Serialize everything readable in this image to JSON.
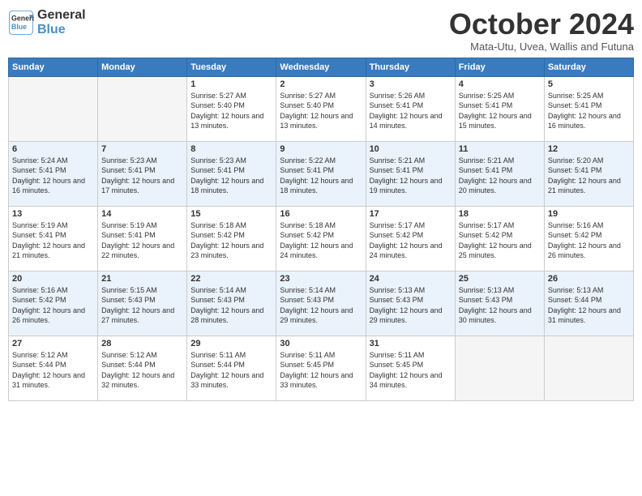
{
  "app": {
    "name": "GeneralBlue",
    "name_line1": "General",
    "name_line2": "Blue"
  },
  "calendar": {
    "month": "October 2024",
    "location": "Mata-Utu, Uvea, Wallis and Futuna",
    "weekdays": [
      "Sunday",
      "Monday",
      "Tuesday",
      "Wednesday",
      "Thursday",
      "Friday",
      "Saturday"
    ],
    "weeks": [
      [
        {
          "day": "",
          "sunrise": "",
          "sunset": "",
          "daylight": ""
        },
        {
          "day": "",
          "sunrise": "",
          "sunset": "",
          "daylight": ""
        },
        {
          "day": "1",
          "sunrise": "Sunrise: 5:27 AM",
          "sunset": "Sunset: 5:40 PM",
          "daylight": "Daylight: 12 hours and 13 minutes."
        },
        {
          "day": "2",
          "sunrise": "Sunrise: 5:27 AM",
          "sunset": "Sunset: 5:40 PM",
          "daylight": "Daylight: 12 hours and 13 minutes."
        },
        {
          "day": "3",
          "sunrise": "Sunrise: 5:26 AM",
          "sunset": "Sunset: 5:41 PM",
          "daylight": "Daylight: 12 hours and 14 minutes."
        },
        {
          "day": "4",
          "sunrise": "Sunrise: 5:25 AM",
          "sunset": "Sunset: 5:41 PM",
          "daylight": "Daylight: 12 hours and 15 minutes."
        },
        {
          "day": "5",
          "sunrise": "Sunrise: 5:25 AM",
          "sunset": "Sunset: 5:41 PM",
          "daylight": "Daylight: 12 hours and 16 minutes."
        }
      ],
      [
        {
          "day": "6",
          "sunrise": "Sunrise: 5:24 AM",
          "sunset": "Sunset: 5:41 PM",
          "daylight": "Daylight: 12 hours and 16 minutes."
        },
        {
          "day": "7",
          "sunrise": "Sunrise: 5:23 AM",
          "sunset": "Sunset: 5:41 PM",
          "daylight": "Daylight: 12 hours and 17 minutes."
        },
        {
          "day": "8",
          "sunrise": "Sunrise: 5:23 AM",
          "sunset": "Sunset: 5:41 PM",
          "daylight": "Daylight: 12 hours and 18 minutes."
        },
        {
          "day": "9",
          "sunrise": "Sunrise: 5:22 AM",
          "sunset": "Sunset: 5:41 PM",
          "daylight": "Daylight: 12 hours and 18 minutes."
        },
        {
          "day": "10",
          "sunrise": "Sunrise: 5:21 AM",
          "sunset": "Sunset: 5:41 PM",
          "daylight": "Daylight: 12 hours and 19 minutes."
        },
        {
          "day": "11",
          "sunrise": "Sunrise: 5:21 AM",
          "sunset": "Sunset: 5:41 PM",
          "daylight": "Daylight: 12 hours and 20 minutes."
        },
        {
          "day": "12",
          "sunrise": "Sunrise: 5:20 AM",
          "sunset": "Sunset: 5:41 PM",
          "daylight": "Daylight: 12 hours and 21 minutes."
        }
      ],
      [
        {
          "day": "13",
          "sunrise": "Sunrise: 5:19 AM",
          "sunset": "Sunset: 5:41 PM",
          "daylight": "Daylight: 12 hours and 21 minutes."
        },
        {
          "day": "14",
          "sunrise": "Sunrise: 5:19 AM",
          "sunset": "Sunset: 5:41 PM",
          "daylight": "Daylight: 12 hours and 22 minutes."
        },
        {
          "day": "15",
          "sunrise": "Sunrise: 5:18 AM",
          "sunset": "Sunset: 5:42 PM",
          "daylight": "Daylight: 12 hours and 23 minutes."
        },
        {
          "day": "16",
          "sunrise": "Sunrise: 5:18 AM",
          "sunset": "Sunset: 5:42 PM",
          "daylight": "Daylight: 12 hours and 24 minutes."
        },
        {
          "day": "17",
          "sunrise": "Sunrise: 5:17 AM",
          "sunset": "Sunset: 5:42 PM",
          "daylight": "Daylight: 12 hours and 24 minutes."
        },
        {
          "day": "18",
          "sunrise": "Sunrise: 5:17 AM",
          "sunset": "Sunset: 5:42 PM",
          "daylight": "Daylight: 12 hours and 25 minutes."
        },
        {
          "day": "19",
          "sunrise": "Sunrise: 5:16 AM",
          "sunset": "Sunset: 5:42 PM",
          "daylight": "Daylight: 12 hours and 26 minutes."
        }
      ],
      [
        {
          "day": "20",
          "sunrise": "Sunrise: 5:16 AM",
          "sunset": "Sunset: 5:42 PM",
          "daylight": "Daylight: 12 hours and 26 minutes."
        },
        {
          "day": "21",
          "sunrise": "Sunrise: 5:15 AM",
          "sunset": "Sunset: 5:43 PM",
          "daylight": "Daylight: 12 hours and 27 minutes."
        },
        {
          "day": "22",
          "sunrise": "Sunrise: 5:14 AM",
          "sunset": "Sunset: 5:43 PM",
          "daylight": "Daylight: 12 hours and 28 minutes."
        },
        {
          "day": "23",
          "sunrise": "Sunrise: 5:14 AM",
          "sunset": "Sunset: 5:43 PM",
          "daylight": "Daylight: 12 hours and 29 minutes."
        },
        {
          "day": "24",
          "sunrise": "Sunrise: 5:13 AM",
          "sunset": "Sunset: 5:43 PM",
          "daylight": "Daylight: 12 hours and 29 minutes."
        },
        {
          "day": "25",
          "sunrise": "Sunrise: 5:13 AM",
          "sunset": "Sunset: 5:43 PM",
          "daylight": "Daylight: 12 hours and 30 minutes."
        },
        {
          "day": "26",
          "sunrise": "Sunrise: 5:13 AM",
          "sunset": "Sunset: 5:44 PM",
          "daylight": "Daylight: 12 hours and 31 minutes."
        }
      ],
      [
        {
          "day": "27",
          "sunrise": "Sunrise: 5:12 AM",
          "sunset": "Sunset: 5:44 PM",
          "daylight": "Daylight: 12 hours and 31 minutes."
        },
        {
          "day": "28",
          "sunrise": "Sunrise: 5:12 AM",
          "sunset": "Sunset: 5:44 PM",
          "daylight": "Daylight: 12 hours and 32 minutes."
        },
        {
          "day": "29",
          "sunrise": "Sunrise: 5:11 AM",
          "sunset": "Sunset: 5:44 PM",
          "daylight": "Daylight: 12 hours and 33 minutes."
        },
        {
          "day": "30",
          "sunrise": "Sunrise: 5:11 AM",
          "sunset": "Sunset: 5:45 PM",
          "daylight": "Daylight: 12 hours and 33 minutes."
        },
        {
          "day": "31",
          "sunrise": "Sunrise: 5:11 AM",
          "sunset": "Sunset: 5:45 PM",
          "daylight": "Daylight: 12 hours and 34 minutes."
        },
        {
          "day": "",
          "sunrise": "",
          "sunset": "",
          "daylight": ""
        },
        {
          "day": "",
          "sunrise": "",
          "sunset": "",
          "daylight": ""
        }
      ]
    ]
  }
}
